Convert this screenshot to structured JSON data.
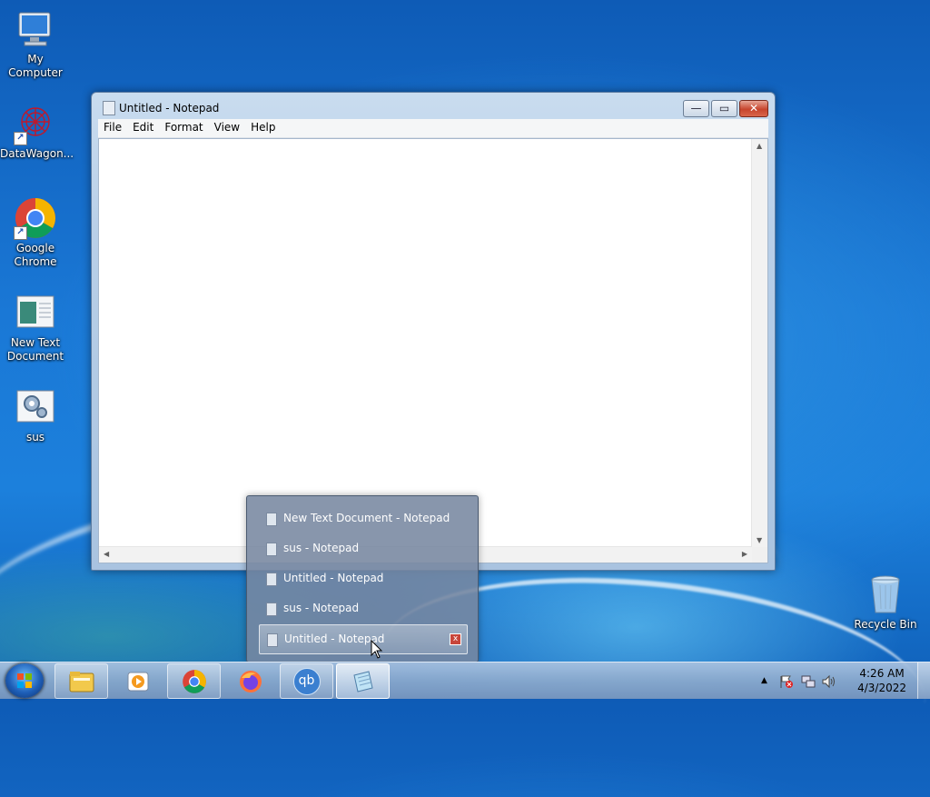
{
  "desktop": {
    "icons": [
      {
        "label": "My Computer"
      },
      {
        "label": "DataWagon..."
      },
      {
        "label": "Google Chrome"
      },
      {
        "label": "New Text Document"
      },
      {
        "label": "sus"
      },
      {
        "label": "Recycle Bin"
      }
    ]
  },
  "window": {
    "title": "Untitled - Notepad",
    "menu": [
      "File",
      "Edit",
      "Format",
      "View",
      "Help"
    ],
    "buttons": {
      "minimize": "—",
      "maximize": "▭",
      "close": "✕"
    }
  },
  "jumplist": {
    "items": [
      {
        "label": "New Text Document - Notepad"
      },
      {
        "label": "sus - Notepad"
      },
      {
        "label": "Untitled - Notepad"
      },
      {
        "label": "sus - Notepad"
      },
      {
        "label": "Untitled - Notepad",
        "hovered": true
      }
    ],
    "close_glyph": "x"
  },
  "taskbar": {
    "apps": [
      {
        "name": "windows-explorer-icon"
      },
      {
        "name": "media-player-icon"
      },
      {
        "name": "chrome-icon"
      },
      {
        "name": "firefox-icon"
      },
      {
        "name": "qbittorrent-icon",
        "text": "qb"
      },
      {
        "name": "notepad-icon"
      }
    ],
    "tray": {
      "show_hidden": "▲"
    },
    "clock": {
      "time": "4:26 AM",
      "date": "4/3/2022"
    }
  },
  "colors": {
    "accent": "#1c80dc",
    "close_red": "#c7452d"
  }
}
